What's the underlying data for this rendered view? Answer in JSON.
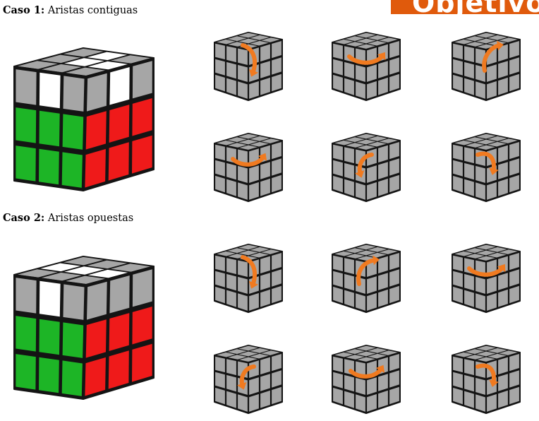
{
  "banner": {
    "text": "Objetivo"
  },
  "colors": {
    "orange": "#f07a20",
    "gray": "#a6a6a6",
    "white": "#ffffff",
    "green": "#1db526",
    "red": "#ef1a1a",
    "black": "#141414"
  },
  "cases": [
    {
      "label": "Caso 1:",
      "title": "Aristas contiguas",
      "target_cube": {
        "top_white_stickers": [
          "front-middle",
          "right-middle"
        ]
      },
      "moves": [
        [
          "arrow-down-right-edge",
          "arrow-swirl-top",
          "arrow-up-right-edge"
        ],
        [
          "arrow-swirl-top-right",
          "arrow-down-center",
          "arrow-curl-center-right"
        ]
      ]
    },
    {
      "label": "Caso 2:",
      "title": "Aristas opuestas",
      "target_cube": {
        "top_white_stickers": [
          "front-middle",
          "back-middle"
        ]
      },
      "moves": [
        [
          "arrow-down-right-edge",
          "arrow-up-center",
          "arrow-swirl-top"
        ],
        [
          "arrow-down-center",
          "arrow-swirl-top-right",
          "arrow-curl-center-right"
        ]
      ]
    }
  ]
}
